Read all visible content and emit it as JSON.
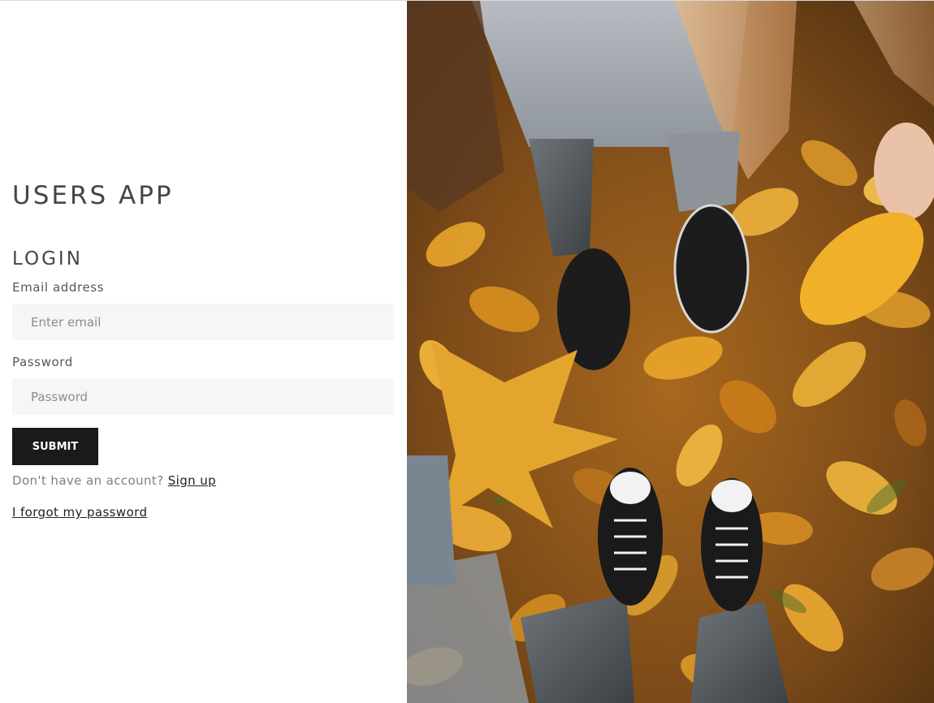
{
  "app": {
    "title": "USERS APP"
  },
  "login": {
    "heading": "LOGIN",
    "email": {
      "label": "Email address",
      "placeholder": "Enter email",
      "value": ""
    },
    "password": {
      "label": "Password",
      "placeholder": "Password",
      "value": ""
    },
    "submit_label": "SUBMIT",
    "signup_prompt": "Don't have an account?",
    "signup_link": "Sign up",
    "forgot_link": "I forgot my password"
  },
  "colors": {
    "button_bg": "#1a1a1a",
    "input_bg": "#f6f6f8",
    "heading_text": "#444648"
  },
  "photo": {
    "icon": "autumn-leaves-sneakers-photo"
  }
}
